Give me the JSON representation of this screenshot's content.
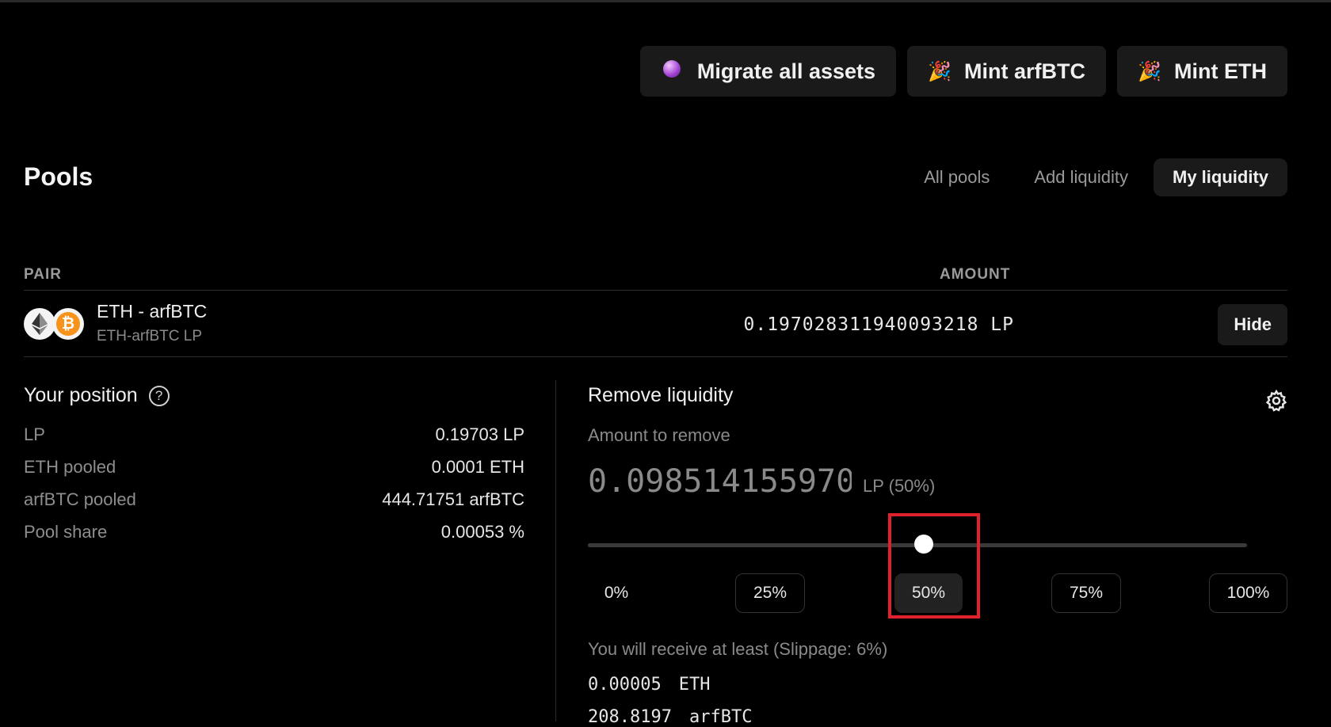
{
  "actions": {
    "migrate_label": "Migrate all assets",
    "mint_arfbtc_label": "Mint arfBTC",
    "mint_eth_label": "Mint ETH"
  },
  "pools": {
    "title": "Pools",
    "tabs": [
      {
        "label": "All pools",
        "active": false
      },
      {
        "label": "Add liquidity",
        "active": false
      },
      {
        "label": "My liquidity",
        "active": true
      }
    ]
  },
  "table": {
    "headers": {
      "pair": "PAIR",
      "amount": "AMOUNT"
    },
    "row": {
      "pair": "ETH - arfBTC",
      "lp_name": "ETH-arfBTC LP",
      "amount": "0.197028311940093218 LP",
      "hide_label": "Hide"
    }
  },
  "position": {
    "title": "Your position",
    "help_icon": "?",
    "rows": [
      {
        "label": "LP",
        "value": "0.19703 LP"
      },
      {
        "label": "ETH pooled",
        "value": "0.0001 ETH"
      },
      {
        "label": "arfBTC pooled",
        "value": "444.71751 arfBTC"
      },
      {
        "label": "Pool share",
        "value": "0.00053 %"
      }
    ]
  },
  "remove": {
    "title": "Remove liquidity",
    "subtitle": "Amount to remove",
    "amount": "0.09851415597004",
    "unit": "LP (50%)",
    "slider_fraction": 0.51,
    "percent_buttons": [
      "0%",
      "25%",
      "50%",
      "75%",
      "100%"
    ],
    "selected_percent": "50%",
    "receive_title": "You will receive at least (Slippage: 6%)",
    "receive": [
      {
        "amount": "0.00005",
        "token": "ETH"
      },
      {
        "amount": "208.8197",
        "token": "arfBTC"
      }
    ]
  },
  "colors": {
    "background": "#000000",
    "highlight": "#e0202a",
    "btc": "#f7931a"
  }
}
